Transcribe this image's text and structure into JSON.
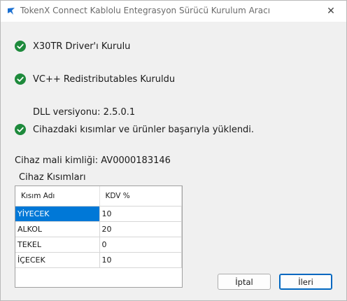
{
  "window": {
    "title": "TokenX Connect Kablolu Entegrasyon Sürücü Kurulum Aracı",
    "close_glyph": "✕"
  },
  "status": [
    {
      "text": "X30TR Driver'ı Kurulu",
      "icon": "check-circle-icon"
    },
    {
      "text": "VC++ Redistributables Kuruldu",
      "icon": "check-circle-icon"
    },
    {
      "text": "Cihazdaki kısımlar ve ürünler başarıyla yüklendi.",
      "icon": "check-circle-icon"
    }
  ],
  "dll_version": "DLL versiyonu: 2.5.0.1",
  "device_id": "Cihaz mali kimliği: AV0000183146",
  "sections_label": "Cihaz Kısımları",
  "table": {
    "headers": [
      "Kısım Adı",
      "KDV %"
    ],
    "rows": [
      [
        "YİYECEK",
        "10"
      ],
      [
        "ALKOL",
        "20"
      ],
      [
        "TEKEL",
        "0"
      ],
      [
        "İÇECEK",
        "10"
      ]
    ],
    "selected_row": 0
  },
  "buttons": {
    "cancel": "İptal",
    "next": "İleri"
  },
  "colors": {
    "success": "#1e8a3c",
    "selection": "#0078d7",
    "primary_border": "#0067c0"
  }
}
